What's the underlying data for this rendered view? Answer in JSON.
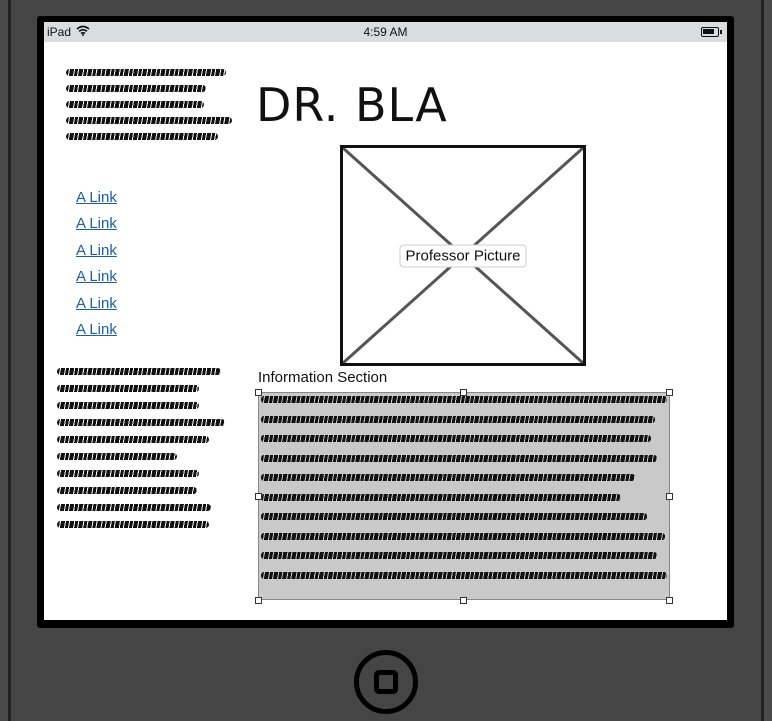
{
  "statusbar": {
    "device_label": "iPad",
    "time": "4:59 AM",
    "wifi_icon": "wifi-icon",
    "battery_icon": "battery-icon"
  },
  "page": {
    "title": "DR. BLA"
  },
  "sidebar": {
    "links": [
      {
        "label": "A Link"
      },
      {
        "label": "A Link"
      },
      {
        "label": "A Link"
      },
      {
        "label": "A Link"
      },
      {
        "label": "A Link"
      },
      {
        "label": "A Link"
      }
    ]
  },
  "image": {
    "label": "Professor Picture"
  },
  "info": {
    "label": "Information Section"
  },
  "colors": {
    "link": "#1a5ea8",
    "info_background": "#c9c9c9",
    "status_bar": "#d9dde0",
    "device": "#454545"
  }
}
